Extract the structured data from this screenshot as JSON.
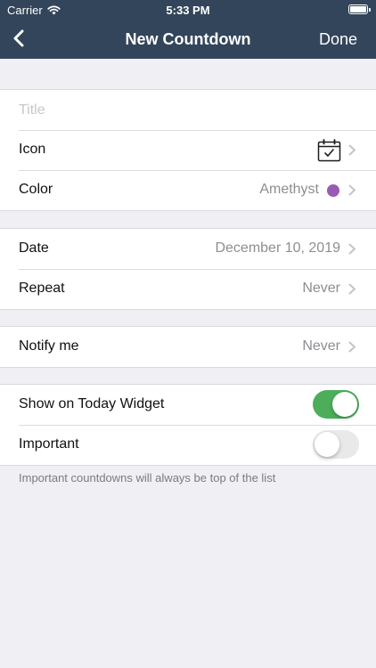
{
  "status_bar": {
    "carrier": "Carrier",
    "time": "5:33 PM"
  },
  "nav": {
    "title": "New Countdown",
    "done_label": "Done"
  },
  "form": {
    "title_placeholder": "Title",
    "title_value": "",
    "icon_label": "Icon",
    "color_label": "Color",
    "color_value": "Amethyst",
    "date_label": "Date",
    "date_value": "December 10, 2019",
    "repeat_label": "Repeat",
    "repeat_value": "Never",
    "notify_label": "Notify me",
    "notify_value": "Never",
    "widget_label": "Show on Today Widget",
    "widget_enabled": true,
    "important_label": "Important",
    "important_enabled": false,
    "important_note": "Important countdowns will always be top of the list"
  },
  "colors": {
    "nav_background": "#33455a",
    "amethyst": "#9b59b6",
    "toggle_on": "#4cae5a"
  },
  "icons": {
    "back": "chevron-left-icon",
    "icon_preview": "calendar-check-icon",
    "disclosure": "chevron-right-icon"
  }
}
